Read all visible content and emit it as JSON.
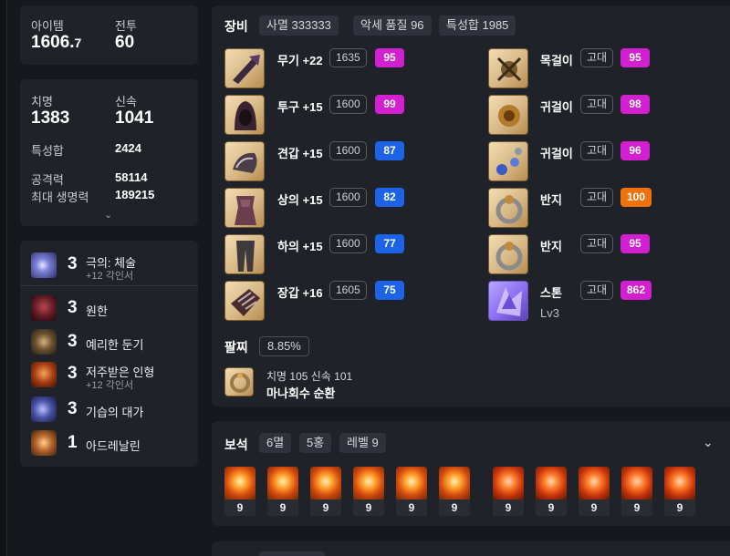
{
  "summary": {
    "item_level_label": "아이템",
    "item_level_main": "1606.",
    "item_level_frac": "7",
    "combat_label": "전투",
    "combat_value": "60"
  },
  "stats": {
    "crit_label": "치명",
    "crit_value": "1383",
    "swift_label": "신속",
    "swift_value": "1041",
    "special_total_label": "특성합",
    "special_total_value": "2424",
    "attack_label": "공격력",
    "attack_value": "58114",
    "hp_label": "최대 생명력",
    "hp_value": "189215",
    "expand_icon": "chevron-down-icon"
  },
  "engravings": [
    {
      "level": "3",
      "name": "극의: 체술",
      "sub": "+12 각인서",
      "color": "#3a3e7a"
    },
    {
      "level": "3",
      "name": "원한",
      "sub": "",
      "color": "#5a1a22"
    },
    {
      "level": "3",
      "name": "예리한 둔기",
      "sub": "",
      "color": "#3d3326"
    },
    {
      "level": "3",
      "name": "저주받은 인형",
      "sub": "+12 각인서",
      "color": "#6a2a12"
    },
    {
      "level": "3",
      "name": "기습의 대가",
      "sub": "",
      "color": "#2c3160"
    },
    {
      "level": "1",
      "name": "아드레날린",
      "sub": "",
      "color": "#7a4a22"
    }
  ],
  "equipment": {
    "title": "장비",
    "chips": [
      "사멸 333333",
      "악세 품질 96",
      "특성합 1985"
    ],
    "gear": [
      {
        "name": "무기 +22",
        "ilvl": "1635",
        "quality": "95",
        "qcolor": "pink"
      },
      {
        "name": "투구 +15",
        "ilvl": "1600",
        "quality": "99",
        "qcolor": "pink"
      },
      {
        "name": "견갑 +15",
        "ilvl": "1600",
        "quality": "87",
        "qcolor": "blue"
      },
      {
        "name": "상의 +15",
        "ilvl": "1600",
        "quality": "82",
        "qcolor": "blue"
      },
      {
        "name": "하의 +15",
        "ilvl": "1600",
        "quality": "77",
        "qcolor": "blue"
      },
      {
        "name": "장갑 +16",
        "ilvl": "1605",
        "quality": "75",
        "qcolor": "blue"
      }
    ],
    "accessories": [
      {
        "name": "목걸이",
        "grade": "고대",
        "quality": "95",
        "qcolor": "pink"
      },
      {
        "name": "귀걸이",
        "grade": "고대",
        "quality": "98",
        "qcolor": "pink"
      },
      {
        "name": "귀걸이",
        "grade": "고대",
        "quality": "96",
        "qcolor": "pink"
      },
      {
        "name": "반지",
        "grade": "고대",
        "quality": "100",
        "qcolor": "orange"
      },
      {
        "name": "반지",
        "grade": "고대",
        "quality": "95",
        "qcolor": "pink"
      },
      {
        "name": "스톤",
        "grade": "고대",
        "quality": "862",
        "qcolor": "pink",
        "sub": "Lv3"
      }
    ],
    "bracelet": {
      "title": "팔찌",
      "chip": "8.85%",
      "line1": "치명 105  신속 101",
      "line2": "마나회수  순환"
    }
  },
  "gems": {
    "title": "보석",
    "chips": [
      "6멸",
      "5홍",
      "레벨 9"
    ],
    "levels": [
      "9",
      "9",
      "9",
      "9",
      "9",
      "9",
      "9",
      "9",
      "9",
      "9",
      "9"
    ],
    "collapse_icon": "chevron-down-icon"
  }
}
